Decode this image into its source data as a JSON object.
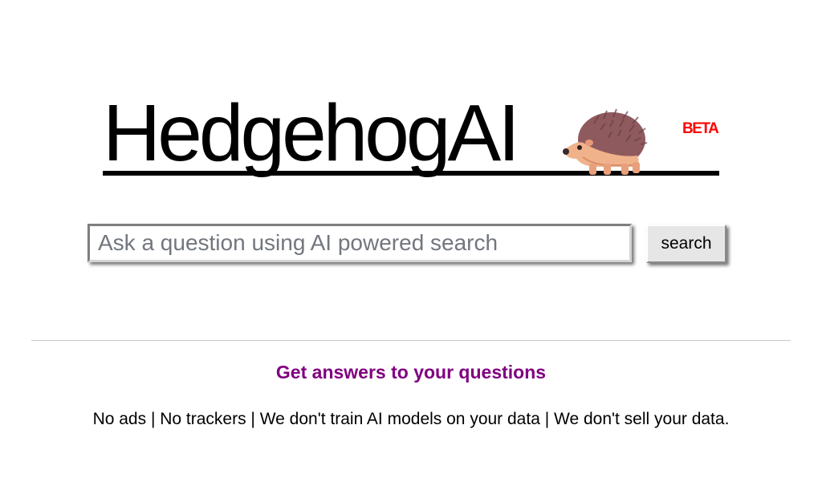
{
  "header": {
    "logo_text": "HedgehogAI",
    "logo_mascot": "hedgehog-icon",
    "beta_label": "BETA"
  },
  "search": {
    "placeholder": "Ask a question using AI powered search",
    "value": "",
    "button_label": "search"
  },
  "main": {
    "tagline": "Get answers to your questions",
    "privacy_note": "No ads | No trackers | We don't train AI models on your data | We don't sell your data."
  },
  "colors": {
    "tagline": "#800080",
    "beta": "#ff0000",
    "mascot_body": "#f0b28a",
    "mascot_spines": "#8e5a5e"
  }
}
